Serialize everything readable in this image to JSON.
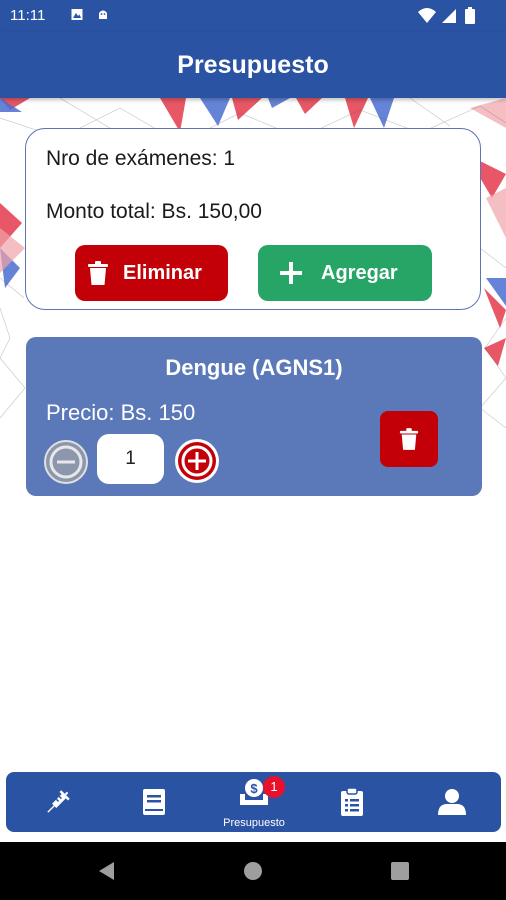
{
  "status_bar": {
    "time": "11:11",
    "icons": [
      "gallery-icon",
      "android-debug-icon",
      "wifi-icon",
      "signal-icon",
      "battery-icon"
    ]
  },
  "header": {
    "title": "Presupuesto"
  },
  "summary": {
    "exam_count_text": "Nro de exámenes: 1",
    "total_text": "Monto total: Bs. 150,00",
    "delete_button_label": "Eliminar",
    "add_button_label": "Agregar"
  },
  "items": [
    {
      "name": "Dengue (AGNS1)",
      "price_text": "Precio: Bs. 150",
      "quantity": "1"
    }
  ],
  "bottom_nav": {
    "items": [
      {
        "icon": "syringe-icon",
        "label": ""
      },
      {
        "icon": "book-icon",
        "label": ""
      },
      {
        "icon": "budget-icon",
        "label": "Presupuesto",
        "badge": "1",
        "active": true
      },
      {
        "icon": "clipboard-icon",
        "label": ""
      },
      {
        "icon": "user-icon",
        "label": ""
      }
    ]
  },
  "colors": {
    "primary": "#2b53a4",
    "card_blue": "#5b78b9",
    "danger": "#c30008",
    "success": "#27a567",
    "badge": "#e8102a"
  }
}
